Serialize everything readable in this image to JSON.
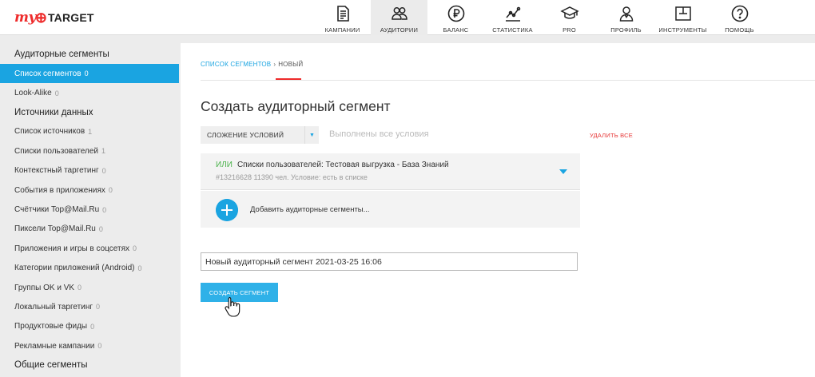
{
  "logo": {
    "my": "my",
    "target": "TARGET"
  },
  "nav": [
    {
      "key": "campaigns",
      "label": "КАМПАНИИ",
      "icon": "document-icon",
      "active": false
    },
    {
      "key": "audiences",
      "label": "АУДИТОРИИ",
      "icon": "users-icon",
      "active": true
    },
    {
      "key": "balance",
      "label": "БАЛАНС",
      "icon": "ruble-icon",
      "active": false
    },
    {
      "key": "stats",
      "label": "СТАТИСТИКА",
      "icon": "chart-line-icon",
      "active": false
    },
    {
      "key": "pro",
      "label": "PRO",
      "icon": "graduation-cap-icon",
      "active": false
    },
    {
      "key": "profile",
      "label": "ПРОФИЛЬ",
      "icon": "user-icon",
      "active": false
    },
    {
      "key": "tools",
      "label": "ИНСТРУМЕНТЫ",
      "icon": "tools-icon",
      "active": false
    },
    {
      "key": "help",
      "label": "ПОМОЩЬ",
      "icon": "question-icon",
      "active": false
    }
  ],
  "sidebar": {
    "sections": [
      {
        "heading": "Аудиторные сегменты",
        "items": [
          {
            "label": "Список сегментов",
            "count": "0",
            "active": true
          },
          {
            "label": "Look-Alike",
            "count": "0",
            "active": false
          }
        ]
      },
      {
        "heading": "Источники данных",
        "items": [
          {
            "label": "Список источников",
            "count": "1",
            "active": false
          },
          {
            "label": "Списки пользователей",
            "count": "1",
            "active": false
          },
          {
            "label": "Контекстный таргетинг",
            "count": "0",
            "active": false
          },
          {
            "label": "События в приложениях",
            "count": "0",
            "active": false
          },
          {
            "label": "Счётчики Top@Mail.Ru",
            "count": "0",
            "active": false
          },
          {
            "label": "Пиксели Top@Mail.Ru",
            "count": "0",
            "active": false
          },
          {
            "label": "Приложения и игры в соцсетях",
            "count": "0",
            "active": false
          },
          {
            "label": "Категории приложений (Android)",
            "count": "0",
            "active": false
          },
          {
            "label": "Группы OK и VK",
            "count": "0",
            "active": false
          },
          {
            "label": "Локальный таргетинг",
            "count": "0",
            "active": false
          },
          {
            "label": "Продуктовые фиды",
            "count": "0",
            "active": false
          },
          {
            "label": "Рекламные кампании",
            "count": "0",
            "active": false
          }
        ]
      },
      {
        "heading": "Общие сегменты",
        "items": []
      }
    ]
  },
  "breadcrumb": {
    "link": "СПИСОК СЕГМЕНТОВ",
    "separator": "›",
    "current": "НОВЫЙ"
  },
  "page_title": "Создать аудиторный сегмент",
  "condition": {
    "select_value": "СЛОЖЕНИЕ УСЛОВИЙ",
    "placeholder": "Выполнены все условия",
    "delete_all": "УДАЛИТЬ ВСЕ"
  },
  "segment": {
    "operator": "ИЛИ",
    "title": "Списки пользователей: Тестовая выгрузка - База Знаний",
    "meta": "#13216628  11390 чел.  Условие: есть в списке"
  },
  "add_segments": "Добавить аудиторные сегменты...",
  "name_input": {
    "value": "Новый аудиторный сегмент 2021-03-25 16:06"
  },
  "create_button": "СОЗДАТЬ СЕГМЕНТ",
  "colors": {
    "accent": "#1aa4e1",
    "brand": "#ee2b2b",
    "success": "#4cb34c",
    "danger": "#e63636"
  }
}
